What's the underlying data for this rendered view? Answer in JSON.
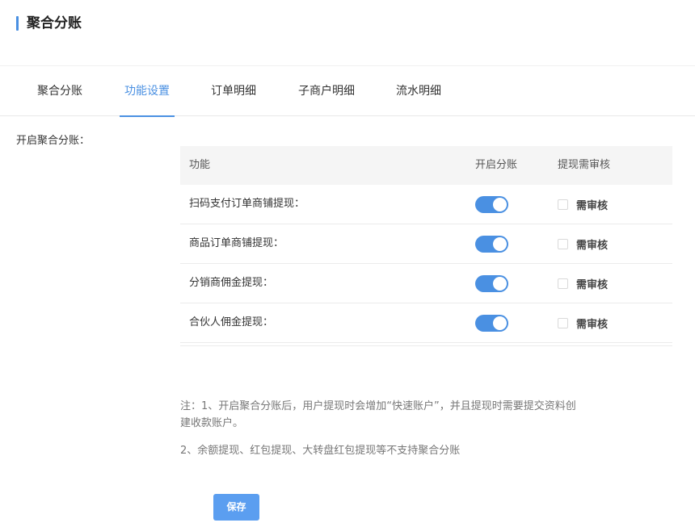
{
  "header": {
    "title": "聚合分账"
  },
  "tabs": [
    {
      "label": "聚合分账",
      "active": false
    },
    {
      "label": "功能设置",
      "active": true
    },
    {
      "label": "订单明细",
      "active": false
    },
    {
      "label": "子商户明细",
      "active": false
    },
    {
      "label": "流水明细",
      "active": false
    }
  ],
  "section": {
    "label": "开启聚合分账："
  },
  "table": {
    "columns": [
      "功能",
      "开启分账",
      "提现需审核"
    ],
    "rows": [
      {
        "name": "扫码支付订单商铺提现：",
        "enabled": true,
        "review_label": "需审核",
        "review_checked": false
      },
      {
        "name": "商品订单商铺提现：",
        "enabled": true,
        "review_label": "需审核",
        "review_checked": false
      },
      {
        "name": "分销商佣金提现：",
        "enabled": true,
        "review_label": "需审核",
        "review_checked": false
      },
      {
        "name": "合伙人佣金提现：",
        "enabled": true,
        "review_label": "需审核",
        "review_checked": false
      }
    ]
  },
  "notes": [
    "注：1、开启聚合分账后，用户提现时会增加“快速账户”，并且提现时需要提交资料创建收款账户。",
    "2、余额提现、红包提现、大转盘红包提现等不支持聚合分账"
  ],
  "actions": {
    "save_label": "保存"
  },
  "colors": {
    "accent": "#4a90e2",
    "save_button": "#5b9ef0"
  }
}
